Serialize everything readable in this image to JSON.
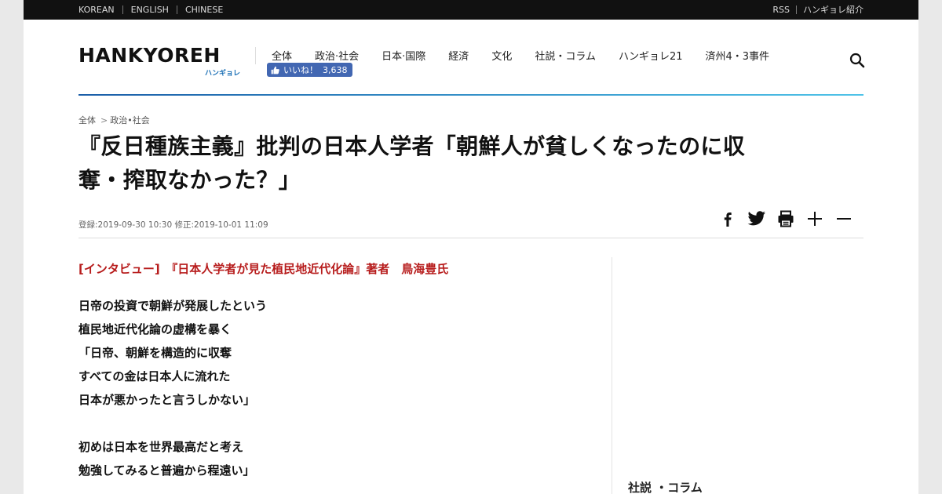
{
  "topbar": {
    "languages": [
      "KOREAN",
      "ENGLISH",
      "CHINESE"
    ],
    "rss": "RSS",
    "about": "ハンギョレ紹介"
  },
  "logo": {
    "wordmark": "HANKYOREH",
    "subtitle": "ハンギョレ"
  },
  "nav": [
    "全体",
    "政治·社会",
    "日本·国際",
    "経済",
    "文化",
    "社説・コラム",
    "ハンギョレ21",
    "済州4・3事件"
  ],
  "like_button": {
    "label": "いいね！",
    "count": "3,638"
  },
  "breadcrumb": {
    "root": "全体",
    "separator": ">",
    "section": "政治•社会"
  },
  "article": {
    "title_line1": "『反日種族主義』批判の日本人学者「朝鮮人が貧しくなったのに収",
    "title_line2": "奪・搾取なかった？」",
    "meta": "登録:2019-09-30 10:30 修正:2019-10-01 11:09",
    "lead": "[インタビュー]　『日本人学者が見た植民地近代化論』著者　鳥海豊氏",
    "para1": [
      "日帝の投資で朝鮮が発展したという",
      "植民地近代化論の虚構を暴く",
      "「日帝、朝鮮を構造的に収奪",
      "すべての金は日本人に流れた",
      "日本が悪かったと言うしかない」"
    ],
    "para2": [
      "初めは日本を世界最高だと考え",
      "勉強してみると普遍から程遠い」"
    ]
  },
  "sidebar": {
    "heading": "社説 ・コラム"
  },
  "colors": {
    "lead_red": "#b71c1c",
    "facebook_blue": "#4267b2",
    "accent_blue": "#1b5ea8"
  },
  "icons": [
    "facebook-icon",
    "twitter-icon",
    "print-icon",
    "font-increase-icon",
    "font-decrease-icon",
    "search-icon",
    "thumbs-up-icon"
  ]
}
